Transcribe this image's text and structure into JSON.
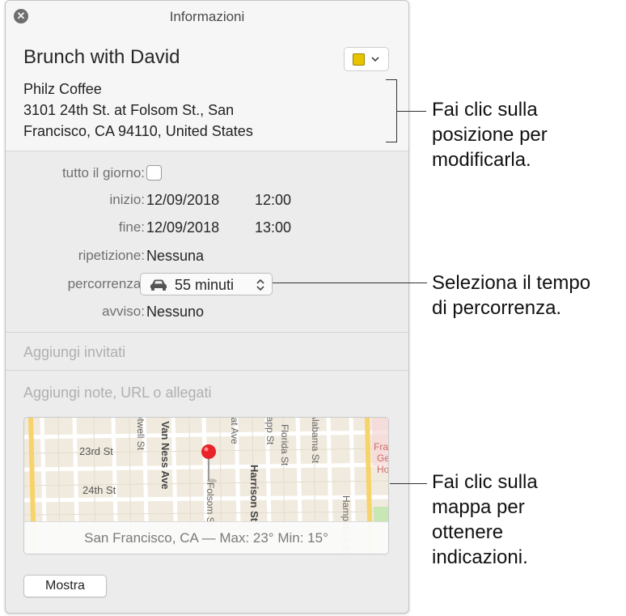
{
  "panel": {
    "title": "Informazioni",
    "close_icon": "close-icon",
    "event_title": "Brunch with David",
    "calendar_color": "#e6c500",
    "color_chevron": "⌄",
    "location_lines": [
      "Philz Coffee",
      "3101 24th St. at Folsom St., San",
      "Francisco, CA 94110, United States"
    ]
  },
  "details": {
    "all_day_label": "tutto il giorno:",
    "all_day_checked": false,
    "start_label": "inizio:",
    "start_date": "12/09/2018",
    "start_time": "12:00",
    "end_label": "fine:",
    "end_date": "12/09/2018",
    "end_time": "13:00",
    "repeat_label": "ripetizione:",
    "repeat_value": "Nessuna",
    "travel_label": "percorrenza:",
    "travel_value": "55 minuti",
    "travel_icon": "car-icon",
    "alert_label": "avviso:",
    "alert_value": "Nessuno"
  },
  "invitees_placeholder": "Aggiungi invitati",
  "notes_placeholder": "Aggiungi note, URL o allegati",
  "map": {
    "street_labels": [
      "23rd St",
      "24th St",
      "Folsom St",
      "Harrison St",
      "Florida St",
      "Alabama St",
      "Shotwell St",
      "Treat Ave",
      "Hampshire St",
      "Capp St",
      "S Van Ness Ave"
    ],
    "poi_label_lines": [
      "Fra",
      "Ge",
      "Ho"
    ],
    "caption": "San Francisco, CA — Max: 23° Min: 15°"
  },
  "show_button_label": "Mostra",
  "callouts": {
    "location": [
      "Fai clic sulla",
      "posizione per",
      "modificarla."
    ],
    "travel": [
      "Seleziona il tempo",
      "di percorrenza."
    ],
    "map": [
      "Fai clic sulla",
      "mappa per",
      "ottenere",
      "indicazioni."
    ]
  }
}
